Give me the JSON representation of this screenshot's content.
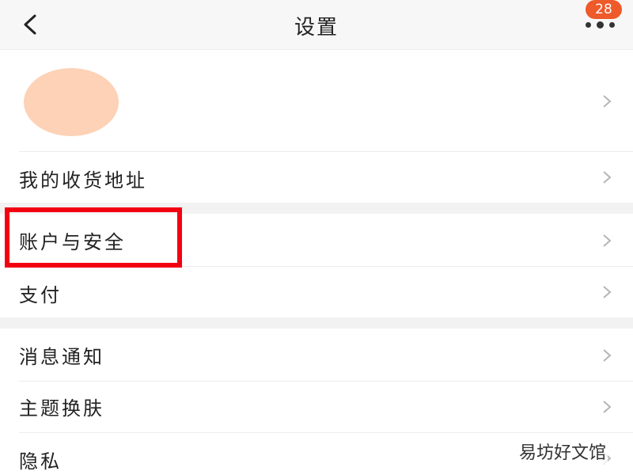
{
  "header": {
    "title": "设置",
    "badge_count": "28"
  },
  "settings": {
    "address": "我的收货地址",
    "account_security": "账户与安全",
    "payment": "支付",
    "notifications": "消息通知",
    "theme": "主题换肤",
    "privacy": "隐私"
  },
  "watermark": "易坊好文馆",
  "colors": {
    "badge": "#ee5a2a",
    "highlight_box": "#f30012",
    "avatar": "#fdd2b6",
    "section_gap": "#f2f2f2"
  },
  "icons": {
    "back": "chevron-left-icon",
    "more": "more-dots-icon",
    "row_arrow": "chevron-right-icon"
  }
}
